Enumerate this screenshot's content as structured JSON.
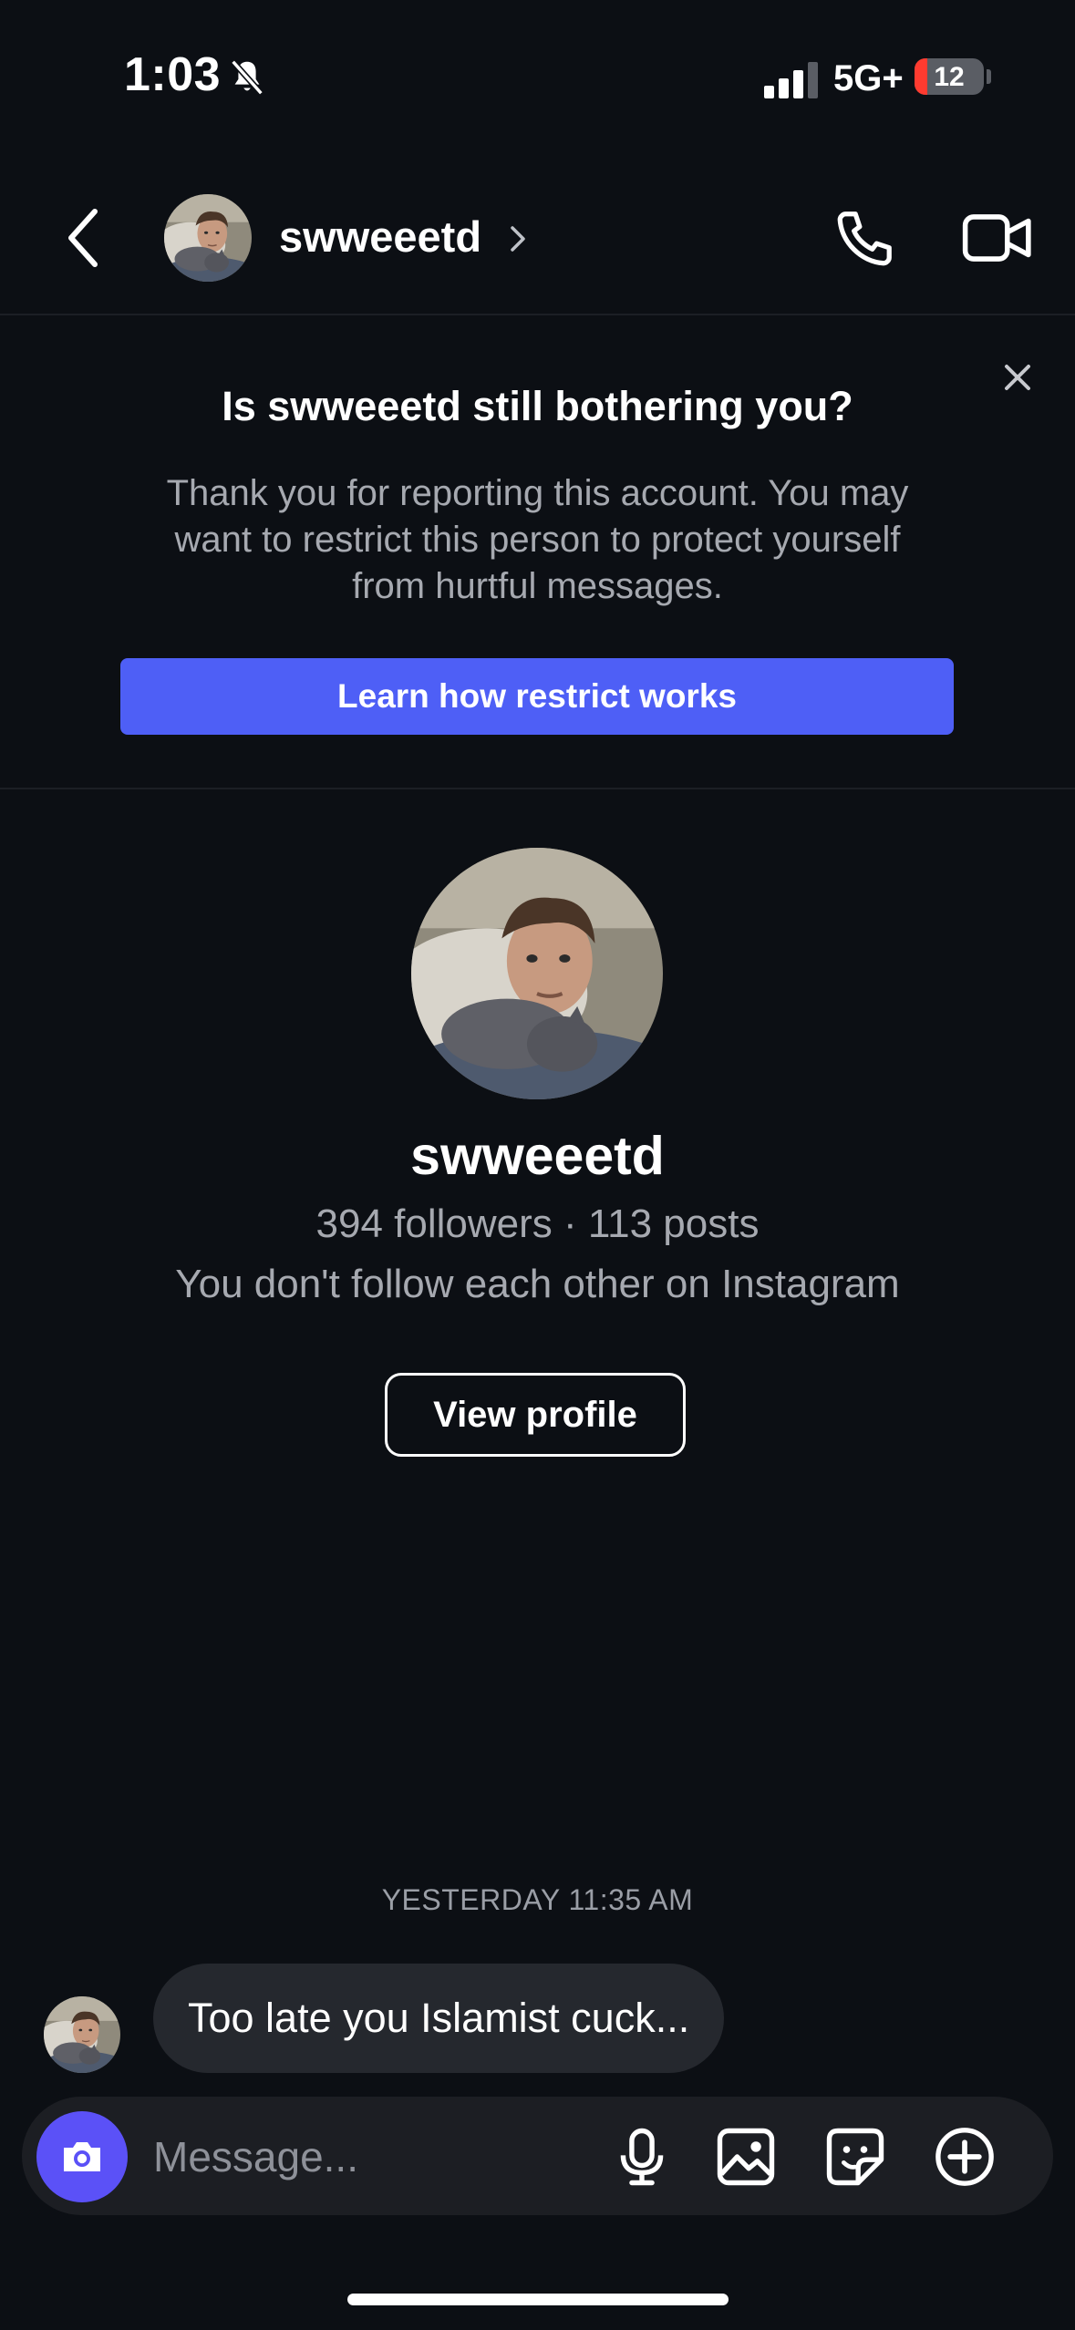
{
  "status_bar": {
    "time": "1:03",
    "network": "5G+",
    "battery": "12",
    "icons": [
      "bell-slash-icon",
      "signal-bars-icon",
      "battery-icon"
    ]
  },
  "header": {
    "username": "swweeetd",
    "icons": [
      "back-chevron-icon",
      "avatar",
      "chevron-right-icon",
      "phone-icon",
      "video-camera-icon"
    ]
  },
  "restrict_banner": {
    "title": "Is swweeetd still bothering you?",
    "body": "Thank you for reporting this account. You may want to restrict this person to protect yourself from hurtful messages.",
    "button_label": "Learn how restrict works",
    "close_icon": "close-icon"
  },
  "profile_card": {
    "username": "swweeetd",
    "stats": "394 followers · 113 posts",
    "follow_status": "You don't follow each other on Instagram",
    "button_label": "View profile"
  },
  "thread": {
    "timestamp": "YESTERDAY 11:35 AM",
    "messages": [
      {
        "sender": "swweeetd",
        "text": "Too late you Islamist cuck..."
      }
    ]
  },
  "composer": {
    "placeholder": "Message...",
    "icons": [
      "camera-icon",
      "microphone-icon",
      "gallery-icon",
      "sticker-icon",
      "plus-circle-icon"
    ]
  },
  "colors": {
    "background": "#0c0f14",
    "accent_button": "#4e5ff6",
    "camera_button": "#5b51f7",
    "bubble": "#25282e",
    "muted_text": "#a6a9b0",
    "battery_low": "#ff3b30"
  }
}
